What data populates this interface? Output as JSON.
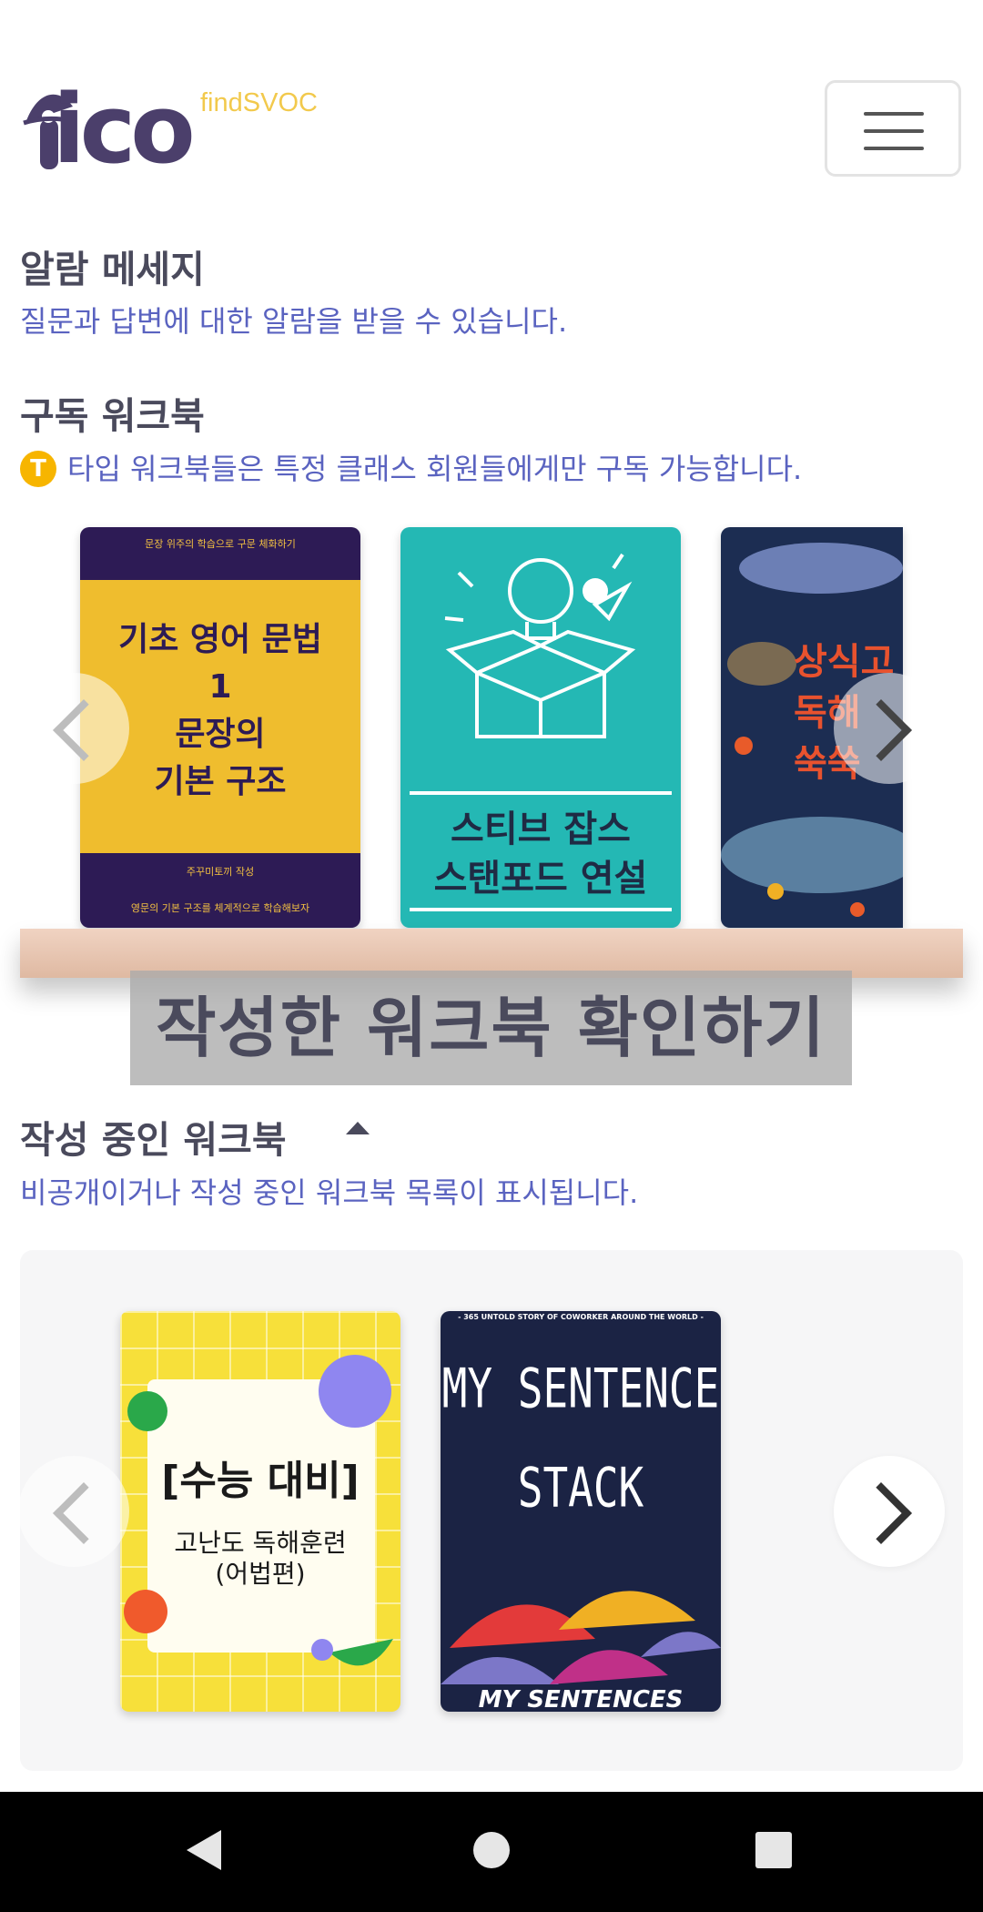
{
  "header": {
    "logo_text": "ico",
    "logo_sub": "findSVOC"
  },
  "alarm": {
    "title": "알람 메세지",
    "desc": "질문과 답변에 대한 알람을 받을 수 있습니다."
  },
  "subscribe": {
    "title": "구독 워크북",
    "badge": "T",
    "desc": "타입 워크북들은 특정 클래스 회원들에게만 구독 가능합니다.",
    "books": [
      {
        "top": "문장 위주의 학습으로 구문 체화하기",
        "title_lines": [
          "기초 영어 문법",
          "1",
          "문장의",
          "기본 구조"
        ],
        "author": "주꾸미토끼 작성",
        "bottom": "영문의 기본 구조를 체계적으로 학습해보자"
      },
      {
        "title_lines": [
          "스티브 잡스",
          "스탠포드 연설"
        ]
      },
      {
        "title_lines": [
          "상식고",
          "독해",
          "쑥쑥"
        ]
      }
    ]
  },
  "overlay": {
    "label": "작성한 워크북 확인하기"
  },
  "drafts": {
    "title": "작성 중인 워크북",
    "desc": "비공개이거나 작성 중인 워크북 목록이 표시됩니다.",
    "books": [
      {
        "title": "[수능 대비]",
        "subtitle_lines": [
          "고난도 독해훈련",
          "(어법편)"
        ]
      },
      {
        "top": "- 365 UNTOLD STORY OF COWORKER AROUND THE WORLD -",
        "title_lines": [
          "MY SENTENCE",
          "STACK"
        ],
        "bottom": "MY SENTENCES"
      }
    ]
  },
  "colors": {
    "accent": "#5a63c0",
    "logo": "#4b3f6b",
    "badge": "#f7b500"
  }
}
